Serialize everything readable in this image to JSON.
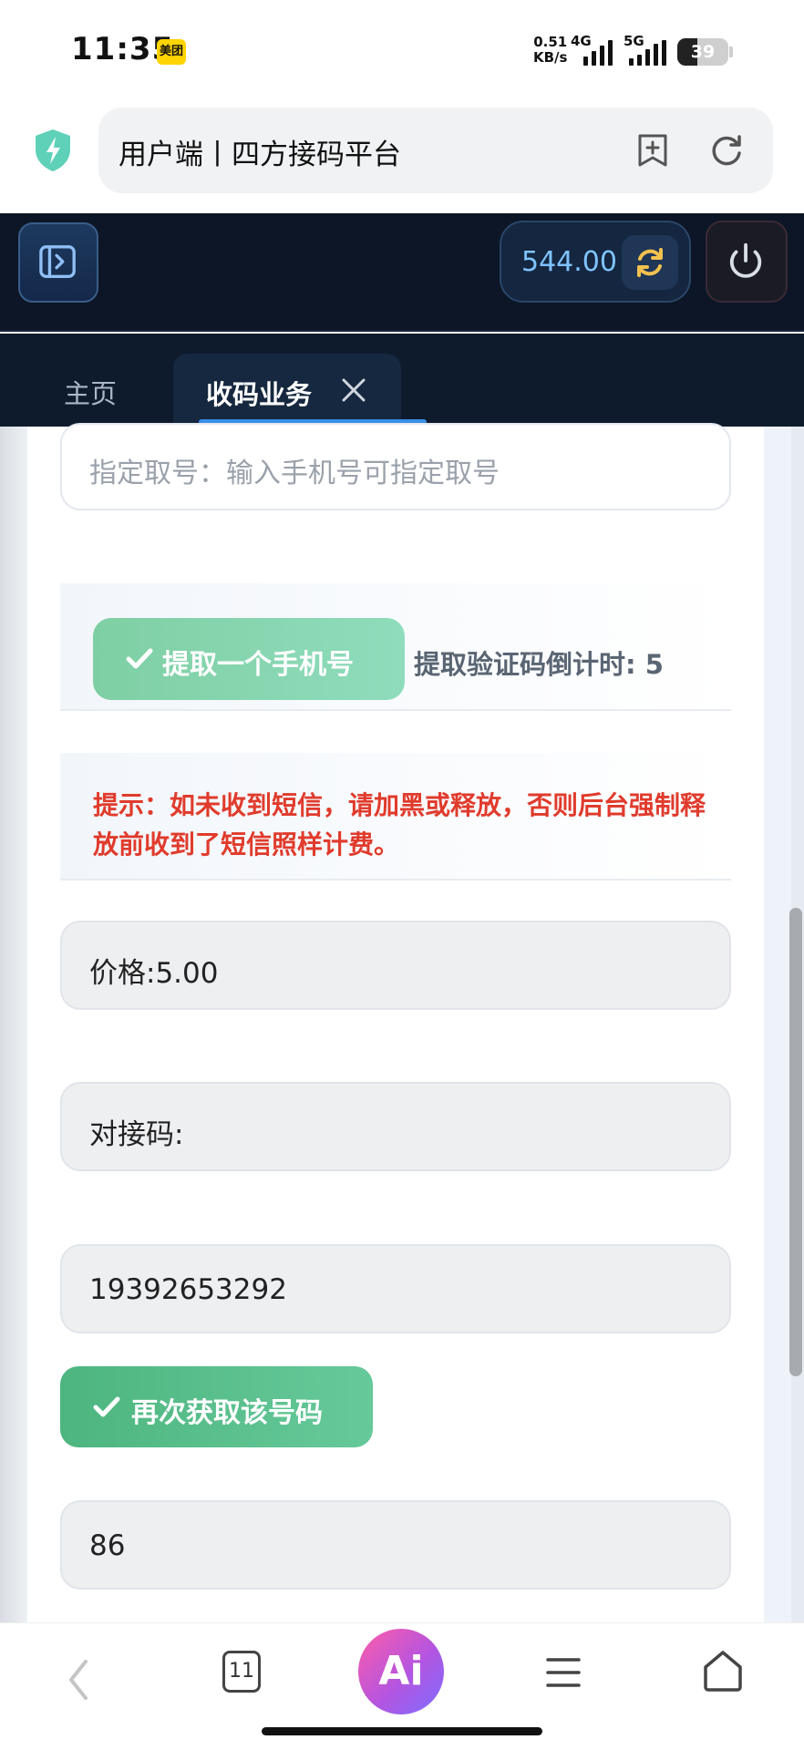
{
  "status_bar": {
    "time": "11:35",
    "app_badge": "美团",
    "net_speed_value": "0.51",
    "net_speed_unit": "KB/s",
    "signal_1_label": "4G",
    "signal_2_label": "5G",
    "battery_percent": 39
  },
  "browser": {
    "url_title": "用户端丨四方接码平台"
  },
  "app_header": {
    "balance": "544.00"
  },
  "tabs": [
    {
      "label": "主页"
    },
    {
      "label": "收码业务"
    }
  ],
  "form": {
    "designate_placeholder": "指定取号：输入手机号可指定取号",
    "extract_button": "提取一个手机号",
    "countdown_label": "提取验证码倒计时: 5",
    "tip": "提示：如未收到短信，请加黑或释放，否则后台强制释放前收到了短信照样计费。",
    "price": "价格:5.00",
    "code_label": "对接码:",
    "phone": "19392653292",
    "reacquire_button": "再次获取该号码",
    "received_code": "86"
  },
  "bottom_nav": {
    "tab_count": "11",
    "ai_label": "Ai"
  },
  "colors": {
    "header_bg": "#0c1626",
    "balance_text": "#7fc4ff",
    "tab_underline": "#3a8fe8",
    "tip_red": "#e03b2c",
    "button_green": "#4db57f"
  }
}
